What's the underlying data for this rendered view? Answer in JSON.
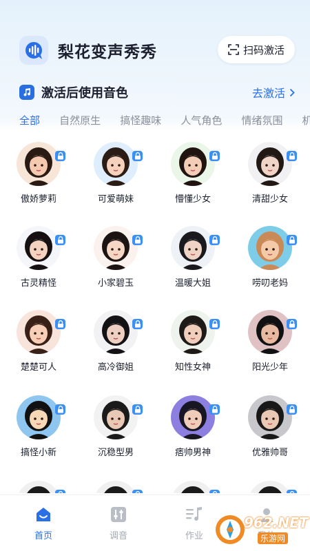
{
  "header": {
    "app_title": "梨花变声秀秀",
    "scan_label": "扫码激活",
    "logo_icon": "voice-wave-icon",
    "accent": "#2b6fe6"
  },
  "section": {
    "title": "激活后使用音色",
    "link_label": "去激活",
    "icon": "music-note-icon"
  },
  "tabs": [
    {
      "label": "全部",
      "active": true
    },
    {
      "label": "自然原生"
    },
    {
      "label": "搞怪趣味"
    },
    {
      "label": "人气角色"
    },
    {
      "label": "情绪氛围"
    },
    {
      "label": "机械"
    }
  ],
  "voices": [
    {
      "label": "傲娇萝莉",
      "colors": [
        "#f7e5d8",
        "#2a1a14",
        "#f5c9b0"
      ]
    },
    {
      "label": "可爱萌妹",
      "colors": [
        "#dfeefd",
        "#2b1c16",
        "#f6d2bd"
      ]
    },
    {
      "label": "懵懂少女",
      "colors": [
        "#e9f6e8",
        "#1f1410",
        "#f3cdb6"
      ]
    },
    {
      "label": "清甜少女",
      "colors": [
        "#f1f1f3",
        "#221814",
        "#f0d4c6"
      ]
    },
    {
      "label": "古灵精怪",
      "colors": [
        "#f5f6f9",
        "#161012",
        "#f4d2c0"
      ]
    },
    {
      "label": "小家碧玉",
      "colors": [
        "#fbf2ee",
        "#1c1412",
        "#f6d6c4"
      ]
    },
    {
      "label": "温暖大姐",
      "colors": [
        "#eef2f6",
        "#1a1a1e",
        "#efd3c4"
      ]
    },
    {
      "label": "唠叨老妈",
      "colors": [
        "#7dcde8",
        "#c98a58",
        "#f4caa8"
      ]
    },
    {
      "label": "楚楚可人",
      "colors": [
        "#f9e4dc",
        "#3a2118",
        "#f6cfb6"
      ]
    },
    {
      "label": "高冷御姐",
      "colors": [
        "#f2f2f4",
        "#141214",
        "#eed0c2"
      ]
    },
    {
      "label": "知性女神",
      "colors": [
        "#eef3ee",
        "#1e1a18",
        "#efcfbc"
      ]
    },
    {
      "label": "阳光少年",
      "colors": [
        "#e0c2c4",
        "#111114",
        "#e6b9a0"
      ]
    },
    {
      "label": "搞怪小新",
      "colors": [
        "#8fc6ef",
        "#111111",
        "#f7d9b8"
      ]
    },
    {
      "label": "沉稳型男",
      "colors": [
        "#f2f2f2",
        "#1a1a1a",
        "#e9c9b5"
      ]
    },
    {
      "label": "痞帅男神",
      "colors": [
        "#8d7fe0",
        "#181622",
        "#efcdb9"
      ]
    },
    {
      "label": "优雅帅哥",
      "colors": [
        "#c8c8cc",
        "#181818",
        "#e9c8b4"
      ]
    },
    {
      "label": "",
      "colors": [
        "#f0f0f0",
        "#1a1a1a",
        "#eccab5"
      ]
    },
    {
      "label": "",
      "colors": [
        "#f0f0f0",
        "#1a1a1a",
        "#eccab5"
      ]
    },
    {
      "label": "",
      "colors": [
        "#f0f0f0",
        "#1a1a1a",
        "#eccab5"
      ]
    },
    {
      "label": "",
      "colors": [
        "#f0f0f0",
        "#1a1a1a",
        "#eccab5"
      ]
    }
  ],
  "bottom_nav": [
    {
      "label": "首页",
      "icon": "home-icon",
      "active": true
    },
    {
      "label": "调音",
      "icon": "equalizer-icon"
    },
    {
      "label": "作业",
      "icon": "music-list-icon"
    },
    {
      "label": "我的",
      "icon": "profile-icon"
    }
  ],
  "watermark": {
    "text": "962.NET",
    "subtext": "乐游网"
  }
}
